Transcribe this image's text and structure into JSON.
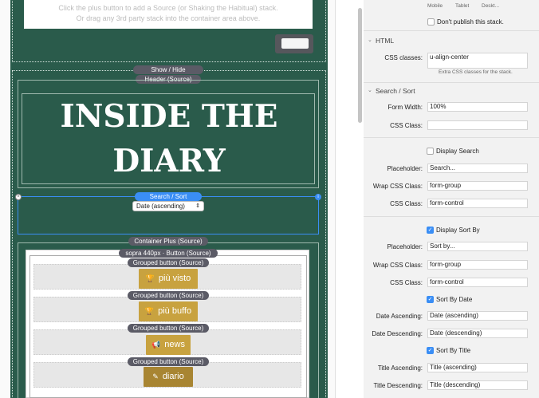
{
  "canvas": {
    "hint_line1": "Click the plus button to add a Source (or Shaking the Habitual) stack.",
    "hint_line2": "Or drag any 3rd party stack into the container area above.",
    "show_hide": "Show / Hide",
    "header_source": "Header (Source)",
    "title_line1": "INSIDE THE",
    "title_line2": "DIARY",
    "search_sort": "Search / Sort",
    "sort_select_value": "Date (ascending)",
    "container_plus": "Container Plus (Source)",
    "button_source": "sopra 440px · Button (Source)",
    "grouped": [
      {
        "label": "Grouped button (Source)",
        "button": "più visto",
        "icon": "trophy-icon",
        "icon_glyph": "🏆"
      },
      {
        "label": "Grouped button (Source)",
        "button": "più buffo",
        "icon": "trophy-icon",
        "icon_glyph": "🏆"
      },
      {
        "label": "Grouped button (Source)",
        "button": "news",
        "icon": "megaphone-icon",
        "icon_glyph": "📢"
      },
      {
        "label": "Grouped button (Source)",
        "button": "diario",
        "icon": "pencil-icon",
        "icon_glyph": "✎"
      }
    ]
  },
  "panel": {
    "devices": [
      "Mobile",
      "Tablet",
      "Deskt..."
    ],
    "dont_publish": "Don't publish this stack.",
    "html_section": "HTML",
    "css_classes_label": "CSS classes:",
    "css_classes_value": "u-align-center",
    "css_classes_note": "Extra CSS classes for the stack.",
    "search_sort_section": "Search / Sort",
    "form_width_label": "Form Width:",
    "form_width_value": "100%",
    "css_class_label": "CSS Class:",
    "css_class_value": "",
    "display_search": "Display Search",
    "placeholder_label": "Placeholder:",
    "placeholder_search_value": "Search...",
    "wrap_css_label": "Wrap CSS Class:",
    "wrap_css_value": "form-group",
    "css_class2_label": "CSS Class:",
    "css_class2_value": "form-control",
    "display_sort_by": "Display Sort By",
    "placeholder_sort_value": "Sort by...",
    "wrap_css2_value": "form-group",
    "css_class3_value": "form-control",
    "sort_by_date": "Sort By Date",
    "date_asc_label": "Date Ascending:",
    "date_asc_value": "Date (ascending)",
    "date_desc_label": "Date Descending:",
    "date_desc_value": "Date (descending)",
    "sort_by_title": "Sort By Title",
    "title_asc_label": "Title Ascending:",
    "title_asc_value": "Title (ascending)",
    "title_desc_label": "Title Descending:",
    "title_desc_value": "Title (descending)"
  },
  "colors": {
    "stack_green": "#2a5b4b",
    "accent_blue": "#3a8ef5",
    "gold": "#c8a23f"
  }
}
